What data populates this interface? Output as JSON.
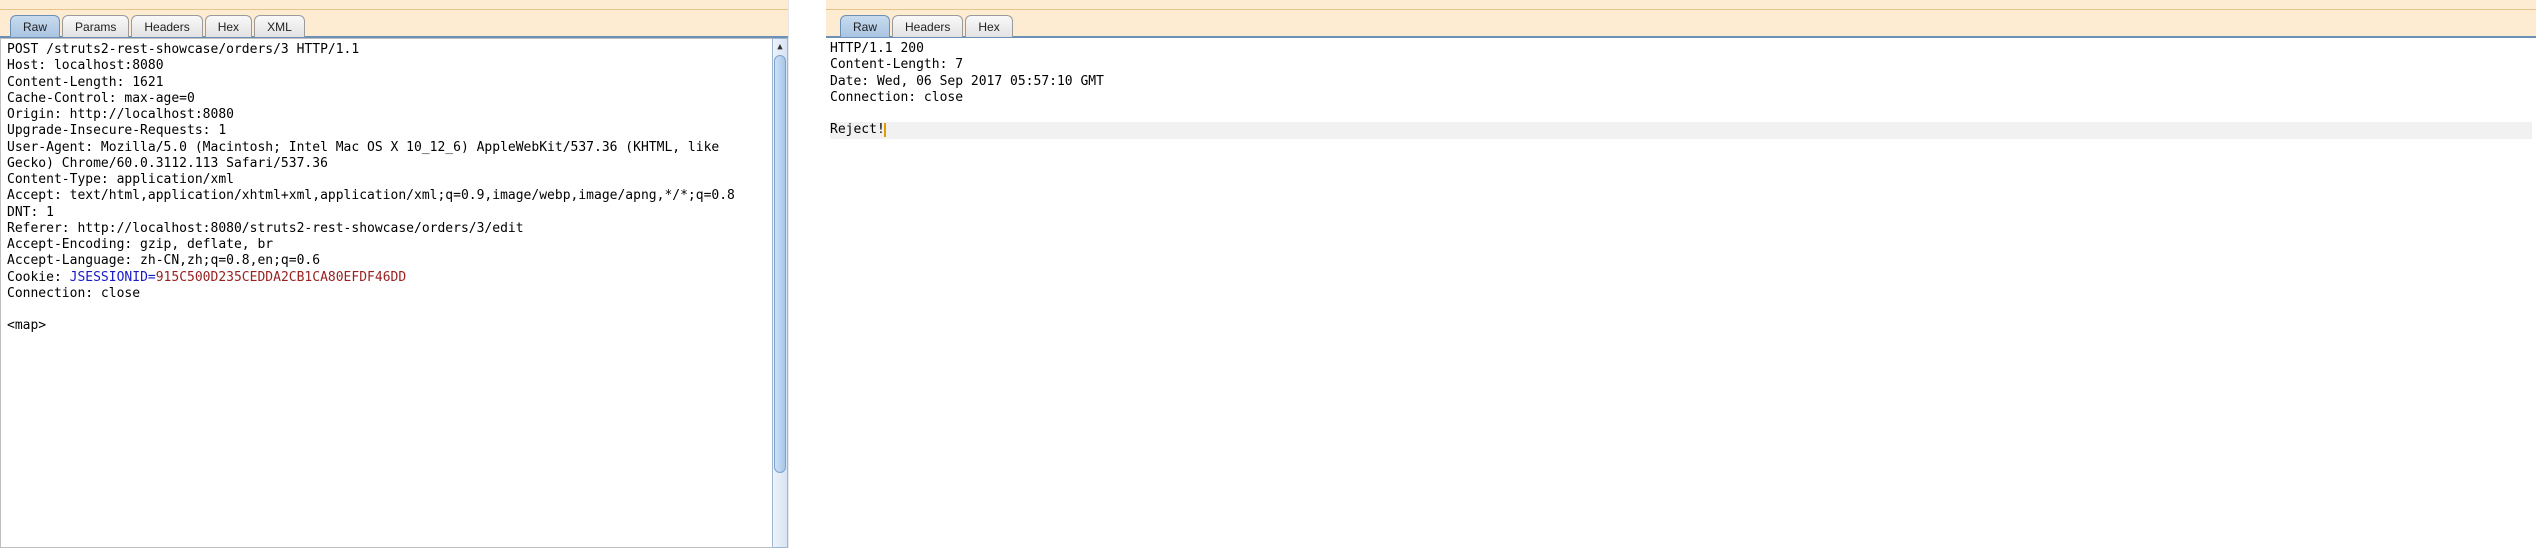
{
  "request": {
    "tabs": [
      "Raw",
      "Params",
      "Headers",
      "Hex",
      "XML"
    ],
    "active_tab": "Raw",
    "lines": [
      "POST /struts2-rest-showcase/orders/3 HTTP/1.1",
      "Host: localhost:8080",
      "Content-Length: 1621",
      "Cache-Control: max-age=0",
      "Origin: http://localhost:8080",
      "Upgrade-Insecure-Requests: 1",
      "User-Agent: Mozilla/5.0 (Macintosh; Intel Mac OS X 10_12_6) AppleWebKit/537.36 (KHTML, like Gecko) Chrome/60.0.3112.113 Safari/537.36",
      "Content-Type: application/xml",
      "Accept: text/html,application/xhtml+xml,application/xml;q=0.9,image/webp,image/apng,*/*;q=0.8",
      "DNT: 1",
      "Referer: http://localhost:8080/struts2-rest-showcase/orders/3/edit",
      "Accept-Encoding: gzip, deflate, br",
      "Accept-Language: zh-CN,zh;q=0.8,en;q=0.6"
    ],
    "cookie_prefix": "Cookie: ",
    "cookie_name": "JSESSIONID=",
    "cookie_value": "915C500D235CEDDA2CB1CA80EFDF46DD",
    "tail_lines": [
      "Connection: close",
      "",
      "<map>"
    ]
  },
  "response": {
    "tabs": [
      "Raw",
      "Headers",
      "Hex"
    ],
    "active_tab": "Raw",
    "header_lines": [
      "HTTP/1.1 200",
      "Content-Length: 7",
      "Date: Wed, 06 Sep 2017 05:57:10 GMT",
      "Connection: close"
    ],
    "body": "Reject!"
  }
}
